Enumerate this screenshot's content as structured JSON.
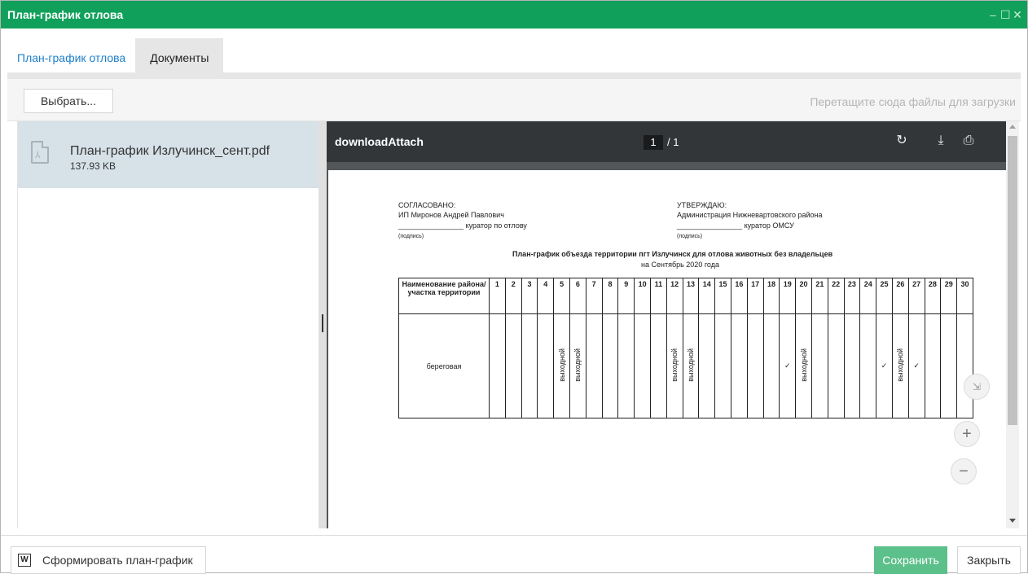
{
  "window": {
    "title": "План-график отлова"
  },
  "tabs": [
    {
      "label": "План-график отлова"
    },
    {
      "label": "Документы"
    }
  ],
  "upload": {
    "choose_label": "Выбрать...",
    "drop_hint": "Перетащите сюда файлы для загрузки"
  },
  "file": {
    "name": "План-график Излучинск_сент.pdf",
    "size": "137.93 KB",
    "icon": "pdf-file-icon"
  },
  "viewer": {
    "title": "downloadAttach",
    "page_current": "1",
    "page_total": "/ 1",
    "icons": [
      "rotate-icon",
      "download-icon",
      "print-icon"
    ]
  },
  "document": {
    "left_block": {
      "heading": "СОГЛАСОВАНО:",
      "name": "ИП Миронов Андрей Павлович",
      "role_line": "________________ куратор по отлову",
      "sign": "(подпись)"
    },
    "right_block": {
      "heading": "УТВЕРЖДАЮ:",
      "name": "Администрация Нижневартовского района",
      "role_line": "________________ куратор ОМСУ",
      "sign": "(подпись)"
    },
    "title": "План-график объезда территории пгт Излучинск для отлова животных без владельцев",
    "subtitle": "на Сентябрь 2020 года",
    "table": {
      "header_label": "Наименование района/участка территории",
      "days": [
        "1",
        "2",
        "3",
        "4",
        "5",
        "6",
        "7",
        "8",
        "9",
        "10",
        "11",
        "12",
        "13",
        "14",
        "15",
        "16",
        "17",
        "18",
        "19",
        "20",
        "21",
        "22",
        "23",
        "24",
        "25",
        "26",
        "27",
        "28",
        "29",
        "30"
      ],
      "row_label": "береговая",
      "cells": [
        "",
        "",
        "",
        "",
        "выходной",
        "выходной",
        "",
        "",
        "",
        "",
        "",
        "выходной",
        "выходной",
        "",
        "",
        "",
        "",
        "",
        "✓",
        "выходной",
        "",
        "",
        "",
        "",
        "✓",
        "выходной",
        "✓",
        "",
        "",
        ""
      ]
    }
  },
  "zoom": {
    "fit": "⇲",
    "in": "+",
    "out": "−"
  },
  "footer": {
    "generate_label": "Сформировать план-график",
    "word_icon": "W",
    "save_label": "Сохранить",
    "close_label": "Закрыть"
  }
}
